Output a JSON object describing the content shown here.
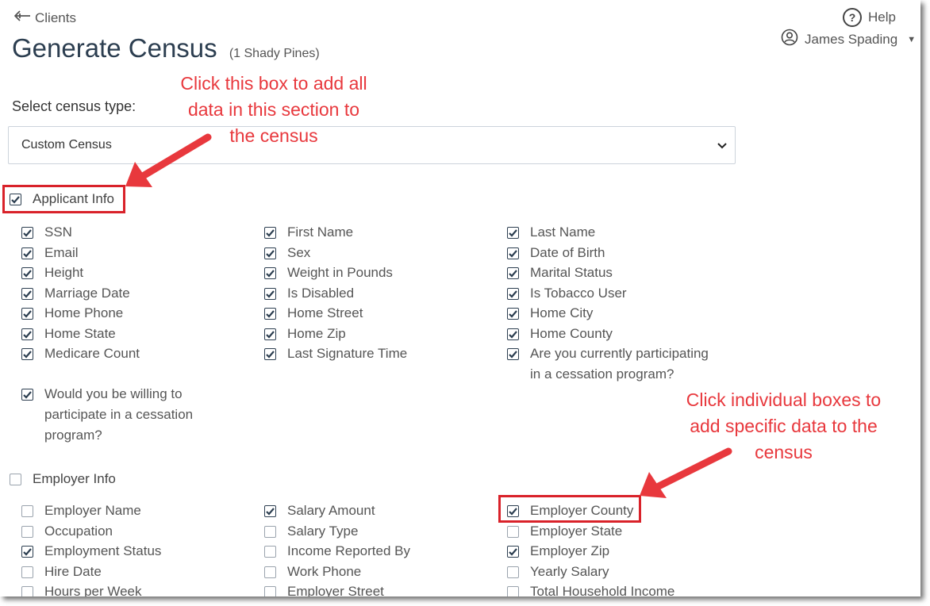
{
  "header": {
    "back_label": "Clients",
    "title": "Generate Census",
    "subtitle": "(1 Shady Pines)",
    "help_label": "Help",
    "user_name": "James Spading"
  },
  "census": {
    "select_label": "Select census type:",
    "selected_type": "Custom Census"
  },
  "annotations": {
    "note_section_1": "Click this box to add all",
    "note_section_2": "data in this section to",
    "note_section_3": "the census",
    "note_individual_1": "Click individual boxes to",
    "note_individual_2": "add specific data to the",
    "note_individual_3": "census",
    "highlight_color": "#d9222a",
    "note_color": "#e8383d"
  },
  "sections": {
    "applicant": {
      "label": "Applicant Info",
      "checked": true,
      "fields": [
        {
          "label": "SSN",
          "checked": true
        },
        {
          "label": "First Name",
          "checked": true
        },
        {
          "label": "Last Name",
          "checked": true
        },
        {
          "label": "Email",
          "checked": true
        },
        {
          "label": "Sex",
          "checked": true
        },
        {
          "label": "Date of Birth",
          "checked": true
        },
        {
          "label": "Height",
          "checked": true
        },
        {
          "label": "Weight in Pounds",
          "checked": true
        },
        {
          "label": "Marital Status",
          "checked": true
        },
        {
          "label": "Marriage Date",
          "checked": true
        },
        {
          "label": "Is Disabled",
          "checked": true
        },
        {
          "label": "Is Tobacco User",
          "checked": true
        },
        {
          "label": "Home Phone",
          "checked": true
        },
        {
          "label": "Home Street",
          "checked": true
        },
        {
          "label": "Home City",
          "checked": true
        },
        {
          "label": "Home State",
          "checked": true
        },
        {
          "label": "Home Zip",
          "checked": true
        },
        {
          "label": "Home County",
          "checked": true
        },
        {
          "label": "Medicare Count",
          "checked": true
        },
        {
          "label": "Last Signature Time",
          "checked": true
        },
        {
          "label": "Are you currently participating in a cessation program?",
          "checked": true
        },
        {
          "label": "Would you be willing to participate in a cessation program?",
          "checked": true
        }
      ]
    },
    "employer": {
      "label": "Employer Info",
      "checked": false,
      "fields": [
        {
          "label": "Employer Name",
          "checked": false
        },
        {
          "label": "Salary Amount",
          "checked": true
        },
        {
          "label": "Employer County",
          "checked": true
        },
        {
          "label": "Occupation",
          "checked": false
        },
        {
          "label": "Salary Type",
          "checked": false
        },
        {
          "label": "Employer State",
          "checked": false
        },
        {
          "label": "Employment Status",
          "checked": true
        },
        {
          "label": "Income Reported By",
          "checked": false
        },
        {
          "label": "Employer Zip",
          "checked": true
        },
        {
          "label": "Hire Date",
          "checked": false
        },
        {
          "label": "Work Phone",
          "checked": false
        },
        {
          "label": "Yearly Salary",
          "checked": false
        },
        {
          "label": "Hours per Week",
          "checked": false
        },
        {
          "label": "Employer Street",
          "checked": false
        },
        {
          "label": "Total Household Income",
          "checked": false
        }
      ]
    }
  }
}
